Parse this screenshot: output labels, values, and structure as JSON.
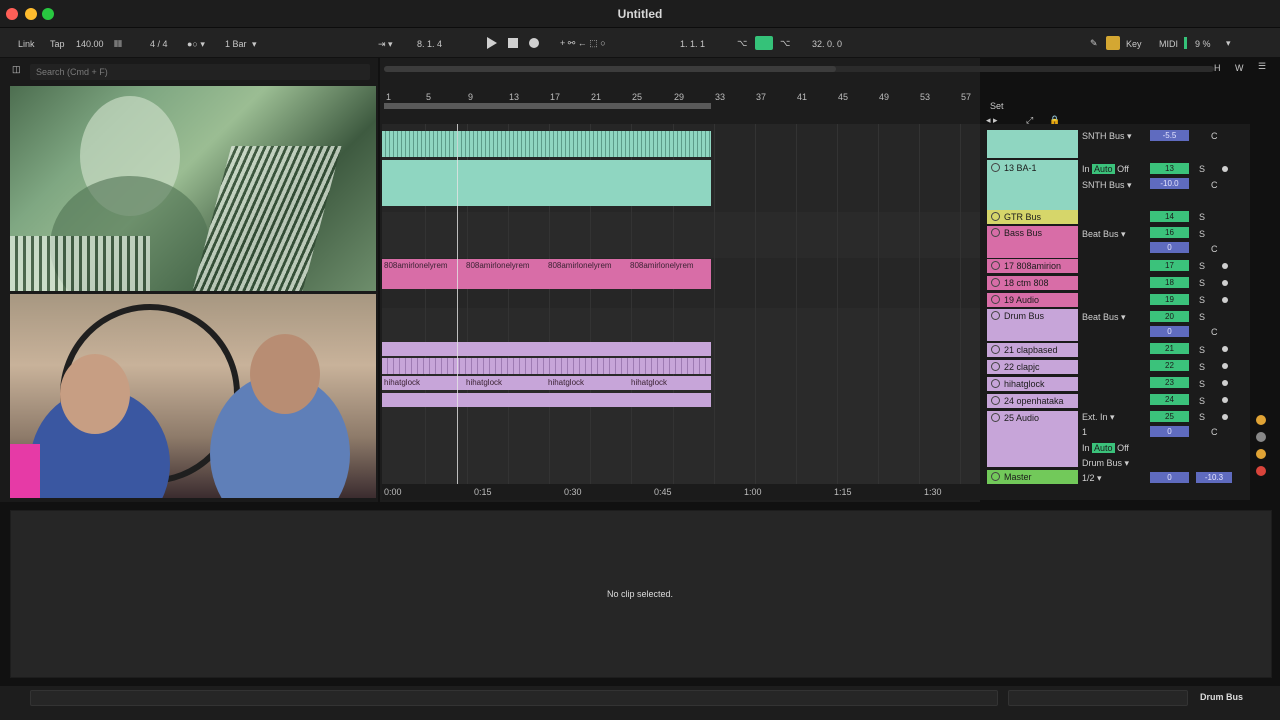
{
  "window": {
    "title": "Untitled"
  },
  "controlbar": {
    "link": "Link",
    "tap": "Tap",
    "tempo": "140.00",
    "signature": "4 / 4",
    "quantize": "1 Bar",
    "arrangement_position": "8.   1.   4",
    "loop_start": "1.   1.   1",
    "loop_length": "32.   0.   0",
    "key": "Key",
    "midi": "MIDI",
    "cpu": "9 %"
  },
  "browser": {
    "search_placeholder": "Search (Cmd + F)"
  },
  "ruler": {
    "bars": [
      "1",
      "5",
      "9",
      "13",
      "17",
      "21",
      "25",
      "29",
      "33",
      "37",
      "41",
      "45",
      "49",
      "53",
      "57"
    ],
    "right_buttons": [
      "H",
      "W"
    ]
  },
  "time_ruler": [
    "0:00",
    "0:15",
    "0:30",
    "0:45",
    "1:00",
    "1:15",
    "1:30"
  ],
  "set_label": "Set",
  "clips": {
    "bass_clip_names": [
      "808amirlonelyrem",
      "808amirlonelyrem",
      "808amirlonelyrem",
      "808amirlonelyrem"
    ],
    "hihat_clip_names": [
      "hihatglock",
      "hihatglock",
      "hihatglock",
      "hihatglock"
    ]
  },
  "tracks": [
    {
      "name": "",
      "io": "SNTH Bus",
      "num": "",
      "vol": "-5.5",
      "pan": "C"
    },
    {
      "name": "13 BA-1",
      "io_in": "In",
      "auto": "Auto",
      "off": "Off",
      "io": "SNTH Bus",
      "num": "13",
      "vol": "-10.0",
      "pan": "C"
    },
    {
      "name": "GTR Bus",
      "num": "14"
    },
    {
      "name": "Bass Bus",
      "io": "Beat Bus",
      "num": "16",
      "vol": "0",
      "pan": "C"
    },
    {
      "name": "17 808amirion",
      "num": "17"
    },
    {
      "name": "18 ctm 808",
      "num": "18"
    },
    {
      "name": "19 Audio",
      "num": "19"
    },
    {
      "name": "Drum Bus",
      "io": "Beat Bus",
      "num": "20",
      "vol": "0",
      "pan": "C"
    },
    {
      "name": "21 clapbased",
      "num": "21"
    },
    {
      "name": "22 clapjc",
      "num": "22"
    },
    {
      "name": "hihatglock",
      "num": "23"
    },
    {
      "name": "24 openhataka",
      "num": "24"
    },
    {
      "name": "25 Audio",
      "io": "Ext. In",
      "io2": "1",
      "io_in": "In",
      "auto": "Auto",
      "off": "Off",
      "io3": "Drum Bus",
      "num": "25",
      "vol": "0",
      "pan": "C"
    },
    {
      "name": "Master",
      "io": "1/2",
      "num": "0",
      "vol": "-10.3"
    }
  ],
  "solo_label": "S",
  "detail": {
    "message": "No clip selected."
  },
  "status": {
    "current_track": "Drum Bus"
  },
  "colors": {
    "teal": "#8fd6c1",
    "pink": "#d86da7",
    "lilac": "#c7a5d9",
    "green": "#3bc27b",
    "yellow": "#d6d66a"
  }
}
